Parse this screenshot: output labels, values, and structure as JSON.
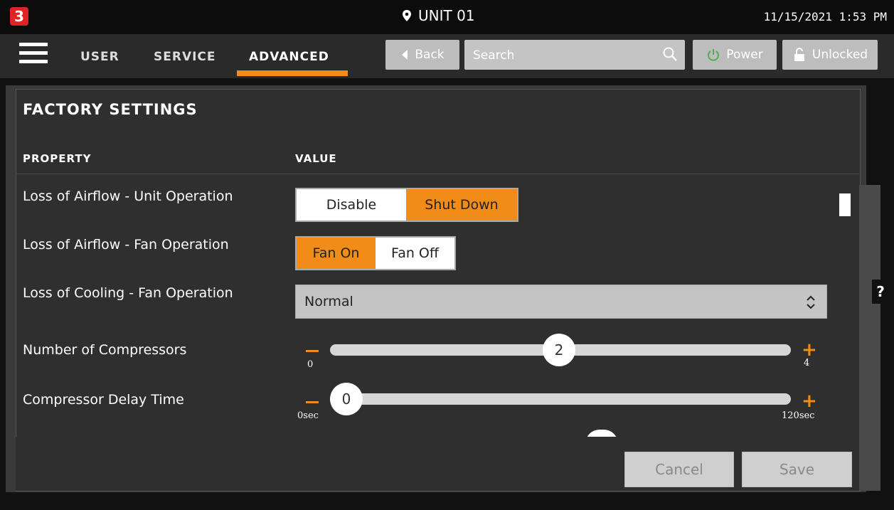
{
  "header": {
    "logo_text": "3",
    "unit_title": "UNIT 01",
    "datetime": "11/15/2021 1:53 PM"
  },
  "nav": {
    "tabs": [
      {
        "label": "USER",
        "active": false
      },
      {
        "label": "SERVICE",
        "active": false
      },
      {
        "label": "ADVANCED",
        "active": true
      }
    ],
    "back_label": "Back",
    "search_placeholder": "Search",
    "power_label": "Power",
    "lock_label": "Unlocked"
  },
  "panel": {
    "title": "FACTORY SETTINGS",
    "col_property": "PROPERTY",
    "col_value": "VALUE"
  },
  "rows": {
    "airflow_unit": {
      "label": "Loss of Airflow - Unit Operation",
      "options": [
        "Disable",
        "Shut Down"
      ],
      "selected": "Shut Down"
    },
    "airflow_fan": {
      "label": "Loss of Airflow - Fan Operation",
      "options": [
        "Fan On",
        "Fan Off"
      ],
      "selected": "Fan On"
    },
    "cooling_fan": {
      "label": "Loss of Cooling - Fan Operation",
      "value": "Normal"
    },
    "num_compressors": {
      "label": "Number of Compressors",
      "value": "2",
      "min_label": "0",
      "max_label": "4",
      "min": 0,
      "max": 4
    },
    "compressor_delay": {
      "label": "Compressor Delay Time",
      "value": "0",
      "min_label": "0sec",
      "max_label": "120sec",
      "min": 0,
      "max": 120
    }
  },
  "dialog": {
    "cancel_label": "Cancel",
    "save_label": "Save"
  },
  "help_label": "?",
  "colors": {
    "accent": "#f28c18",
    "logo": "#e02424",
    "power_icon": "#4caf50"
  }
}
